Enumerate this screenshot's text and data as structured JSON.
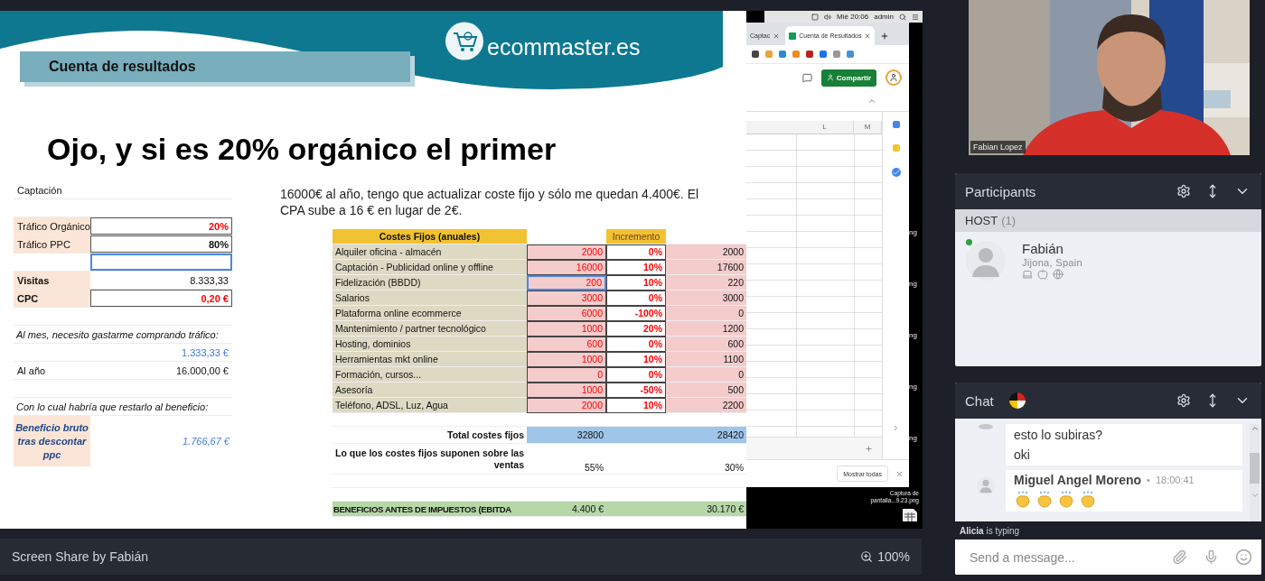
{
  "slide": {
    "section_title": "Cuenta de resultados",
    "logo_text": "ecommaster.es",
    "heading": "Ojo, y si es 20% orgánico el primer",
    "left_sheet": [
      {
        "kind": "cells",
        "label": "Captación",
        "selected": false
      },
      {
        "kind": "blank"
      },
      {
        "kind": "cells",
        "label": "Tráfico Orgánico",
        "value": "20%",
        "color": "#ff0000",
        "shaded": true,
        "value_bold": true,
        "boxed": true,
        "selected": false
      },
      {
        "kind": "cells",
        "label": "Tráfico PPC",
        "value": "80%",
        "shaded": true,
        "value_bold": true,
        "boxed": true,
        "selected": false
      },
      {
        "kind": "cells",
        "selected": true
      },
      {
        "kind": "cells",
        "label": "Visitas",
        "value": "8.333,33",
        "shaded": true,
        "label_bold": true,
        "selected": false
      },
      {
        "kind": "cells",
        "label": "CPC",
        "value": "0,20 €",
        "color": "#ff0000",
        "shaded": true,
        "label_bold": true,
        "value_bold": true,
        "boxed": true,
        "selected": false
      },
      {
        "kind": "blank"
      },
      {
        "kind": "note",
        "text": "Al mes, necesito gastarme comprando tráfico:"
      },
      {
        "kind": "cells",
        "value": "1.333,33 €",
        "color": "#3c78d8",
        "selected": false
      },
      {
        "kind": "cells",
        "label": "Al año",
        "value": "16.000,00 €",
        "selected": false
      },
      {
        "kind": "blank"
      },
      {
        "kind": "note",
        "text": "Con lo cual habría que restarlo al beneficio:"
      },
      {
        "kind": "result",
        "label": "Beneficio bruto tras descontar ppc",
        "value": "1.766,67 €",
        "color": "#3c78d8"
      }
    ],
    "paragraph": "16000€ al año, tengo que actualizar coste fijo y sólo me quedan 4.400€. El CPA sube a 16 € en lugar de 2€.",
    "costs_table": {
      "title": "Costes Fijos (anuales)",
      "increment_header": "Incremento",
      "rows": [
        {
          "label": "Alquiler oficina - almacén",
          "base": "2000",
          "increment": "0%",
          "result": "2000",
          "selected": false
        },
        {
          "label": "Captación - Publicidad online y offline",
          "base": "16000",
          "increment": "10%",
          "result": "17600",
          "selected": false
        },
        {
          "label": "Fidelización (BBDD)",
          "base": "200",
          "increment": "10%",
          "result": "220",
          "selected": true
        },
        {
          "label": "Salarios",
          "base": "3000",
          "increment": "0%",
          "result": "3000",
          "selected": false
        },
        {
          "label": "Plataforma online ecommerce",
          "base": "6000",
          "increment": "-100%",
          "result": "0",
          "selected": false
        },
        {
          "label": "Mantenimiento / partner tecnológico",
          "base": "1000",
          "increment": "20%",
          "result": "1200",
          "selected": false
        },
        {
          "label": "Hosting, dominios",
          "base": "600",
          "increment": "0%",
          "result": "600",
          "selected": false
        },
        {
          "label": "Herramientas mkt online",
          "base": "1000",
          "increment": "10%",
          "result": "1100",
          "selected": false
        },
        {
          "label": "Formación, cursos...",
          "base": "0",
          "increment": "0%",
          "result": "0",
          "selected": false
        },
        {
          "label": "Asesoría",
          "base": "1000",
          "increment": "-50%",
          "result": "500",
          "selected": false
        },
        {
          "label": "Teléfono, ADSL, Luz, Agua",
          "base": "2000",
          "increment": "10%",
          "result": "2200",
          "selected": false
        }
      ],
      "total": {
        "label": "Total costes fijos",
        "base": "32800",
        "result": "28420"
      },
      "ratio": {
        "label": "Lo que los costes fijos suponen sobre las ventas",
        "base": "55%",
        "result": "30%"
      },
      "ebitda": {
        "label": "BENEFICIOS ANTES DE IMPUESTOS (EBITDA",
        "base": "4.400 €",
        "result": "30.170 €"
      }
    }
  },
  "browser": {
    "menubar": [
      "Mié 20:06",
      "admin"
    ],
    "tabs": [
      {
        "label": "Captac",
        "selected": false
      },
      {
        "label": "Cuenta de Resultados",
        "selected": true
      }
    ],
    "share_button": "Compartir",
    "columns": [
      "L",
      "M"
    ],
    "downloads_button": "Mostrar todas"
  },
  "desktop": {
    "file_labels": [
      "ng",
      "ng",
      "ng",
      "ng",
      "ng"
    ],
    "screenshot_file": "Captura de pantalla...9.23.png"
  },
  "status_bar": {
    "title": "Screen Share by Fabián",
    "zoom": "100%"
  },
  "video": {
    "name": "Fabian Lopez"
  },
  "participants": {
    "title": "Participants",
    "group": "HOST",
    "count": "(1)",
    "items": [
      {
        "name": "Fabián",
        "location": "Jijona, Spain",
        "online": true
      }
    ]
  },
  "chat": {
    "title": "Chat",
    "messages": [
      {
        "kind": "text",
        "lines": [
          "esto lo subiras?",
          "oki"
        ]
      },
      {
        "kind": "claps",
        "author": "Miguel Angel Moreno",
        "separator": "•",
        "time": "18:00:41"
      }
    ],
    "typing": {
      "name": "Alicia",
      "text": "is typing"
    },
    "placeholder": "Send a message..."
  }
}
